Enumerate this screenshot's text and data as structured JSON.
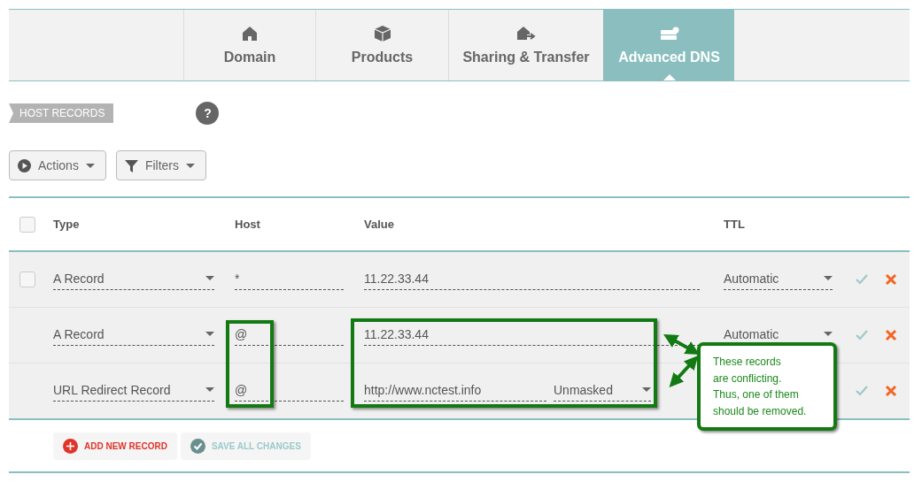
{
  "tabs": [
    {
      "label": "Domain",
      "selected": false
    },
    {
      "label": "Products",
      "selected": false
    },
    {
      "label": "Sharing & Transfer",
      "selected": false
    },
    {
      "label": "Advanced DNS",
      "selected": true
    }
  ],
  "section_label": "HOST RECORDS",
  "help": "?",
  "toolbar": [
    {
      "label": "Actions",
      "kind": "actions"
    },
    {
      "label": "Filters",
      "kind": "filters"
    }
  ],
  "table": {
    "columns": [
      "Type",
      "Host",
      "Value",
      "TTL"
    ],
    "header_checked": false,
    "rows": [
      {
        "selectable": true,
        "checked": false,
        "type": "A Record",
        "host": "*",
        "value": "11.22.33.44",
        "ttl": "Automatic",
        "conflict": false
      },
      {
        "selectable": false,
        "type": "A Record",
        "host": "@",
        "value": "11.22.33.44",
        "ttl": "Automatic",
        "conflict": true
      },
      {
        "selectable": false,
        "type": "URL Redirect Record",
        "host": "@",
        "value": "http://www.nctest.info",
        "redirect_mode": "Unmasked",
        "conflict": true
      }
    ]
  },
  "callout": "These records\nare conflicting.\nThus, one of them\nshould be removed.",
  "footer_buttons": [
    {
      "label": "ADD NEW RECORD",
      "kind": "add"
    },
    {
      "label": "SAVE ALL CHANGES",
      "kind": "save"
    }
  ]
}
